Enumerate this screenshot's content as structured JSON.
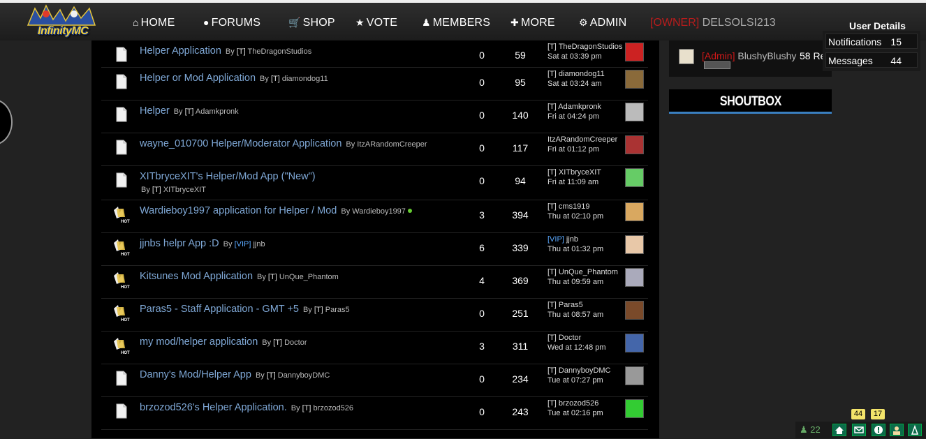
{
  "nav": {
    "logo_text": "InfinityMC",
    "items": [
      {
        "label": "HOME",
        "icon": "home-icon"
      },
      {
        "label": "FORUMS",
        "icon": "chat-bubble-icon"
      },
      {
        "label": "SHOP",
        "icon": "cart-icon"
      },
      {
        "label": "VOTE",
        "icon": "star-icon"
      },
      {
        "label": "MEMBERS",
        "icon": "user-icon"
      },
      {
        "label": "MORE",
        "icon": "plus-icon"
      },
      {
        "label": "ADMIN",
        "icon": "gear-icon"
      }
    ],
    "user_rank": "[OWNER]",
    "username": "DELSOLSI213",
    "user_details_label": "User Details"
  },
  "user_dropdown": {
    "notifications_label": "Notifications",
    "notifications_count": "15",
    "messages_label": "Messages",
    "messages_count": "44"
  },
  "threads": [
    {
      "title": "Helper Application",
      "by": "By",
      "author_prefix": "[T]",
      "author": "TheDragonStudios",
      "replies": "0",
      "views": "59",
      "last_prefix": "[T]",
      "last_user": "TheDragonStudios",
      "last_time": "Sat at 03:39 pm",
      "hot": false,
      "avatar_color": "#c22"
    },
    {
      "title": "Helper or Mod Application",
      "by": "By",
      "author_prefix": "[T]",
      "author": "diamondog11",
      "replies": "0",
      "views": "95",
      "last_prefix": "[T]",
      "last_user": "diamondog11",
      "last_time": "Sat at 03:24 am",
      "hot": false,
      "avatar_color": "#8a6a3a"
    },
    {
      "title": "Helper",
      "by": "By",
      "author_prefix": "[T]",
      "author": "Adamkpronk",
      "replies": "0",
      "views": "140",
      "last_prefix": "[T]",
      "last_user": "Adamkpronk",
      "last_time": "Fri at 04:24 pm",
      "hot": false,
      "avatar_color": "#bbb"
    },
    {
      "title": "wayne_010700 Helper/Moderator Application",
      "by": "By",
      "author_prefix": "",
      "author": "ItzARandomCreeper",
      "replies": "0",
      "views": "117",
      "last_prefix": "",
      "last_user": "ItzARandomCreeper",
      "last_time": "Fri at 01:12 pm",
      "hot": false,
      "avatar_color": "#a33"
    },
    {
      "title": "XITbryceXIT's Helper/Mod App (\"New\")",
      "by": "By",
      "author_prefix": "[T]",
      "author": "XITbryceXIT",
      "replies": "0",
      "views": "94",
      "last_prefix": "[T]",
      "last_user": "XITbryceXIT",
      "last_time": "Fri at 11:09 am",
      "hot": false,
      "avatar_color": "#6c6"
    },
    {
      "title": "Wardieboy1997 application for Helper / Mod",
      "by": "By",
      "author_prefix": "",
      "author": "Wardieboy1997",
      "replies": "3",
      "views": "394",
      "last_prefix": "[T]",
      "last_user": "cms1919",
      "last_time": "Thu at 02:10 pm",
      "hot": true,
      "avatar_color": "#d9a860"
    },
    {
      "title": "jjnbs helpr App :D",
      "by": "By",
      "author_prefix": "[VIP]",
      "author": "jjnb",
      "replies": "6",
      "views": "339",
      "last_prefix": "[VIP]",
      "last_user": "jjnb",
      "last_time": "Thu at 01:32 pm",
      "hot": true,
      "avatar_color": "#e8c8a8"
    },
    {
      "title": "Kitsunes Mod Application",
      "by": "By",
      "author_prefix": "[T]",
      "author": "UnQue_Phantom",
      "replies": "4",
      "views": "369",
      "last_prefix": "[T]",
      "last_user": "UnQue_Phantom",
      "last_time": "Thu at 09:59 am",
      "hot": true,
      "avatar_color": "#aab"
    },
    {
      "title": "Paras5 - Staff Application - GMT +5",
      "by": "By",
      "author_prefix": "[T]",
      "author": "Paras5",
      "replies": "0",
      "views": "251",
      "last_prefix": "[T]",
      "last_user": "Paras5",
      "last_time": "Thu at 08:57 am",
      "hot": true,
      "avatar_color": "#7a4a2a"
    },
    {
      "title": "my mod/helper application",
      "by": "By",
      "author_prefix": "[T]",
      "author": "Doctor",
      "replies": "3",
      "views": "311",
      "last_prefix": "[T]",
      "last_user": "Doctor",
      "last_time": "Wed at 12:48 pm",
      "hot": true,
      "avatar_color": "#46a"
    },
    {
      "title": "Danny's Mod/Helper App",
      "by": "By",
      "author_prefix": "[T]",
      "author": "DannyboyDMC",
      "replies": "0",
      "views": "234",
      "last_prefix": "[T]",
      "last_user": "DannyboyDMC",
      "last_time": "Tue at 07:27 pm",
      "hot": false,
      "avatar_color": "#999"
    },
    {
      "title": "brzozod526's Helper Application.",
      "by": "By",
      "author_prefix": "[T]",
      "author": "brzozod526",
      "replies": "0",
      "views": "243",
      "last_prefix": "[T]",
      "last_user": "brzozod526",
      "last_time": "Tue at 02:16 pm",
      "hot": false,
      "avatar_color": "#3c3"
    }
  ],
  "staff": {
    "rank": "[Admin]",
    "name": "BlushyBlushy",
    "replies_text": "58 Re"
  },
  "shoutbox": {
    "title": "SHOUTBOX"
  },
  "tray": {
    "online_count": "22",
    "messages_badge": "44",
    "alerts_badge": "17"
  },
  "colors": {
    "link": "#7fa8d6",
    "owner_red": "#b81c1c",
    "vip_blue": "#5aa9ff",
    "accent_blue": "#3a7fc0"
  }
}
